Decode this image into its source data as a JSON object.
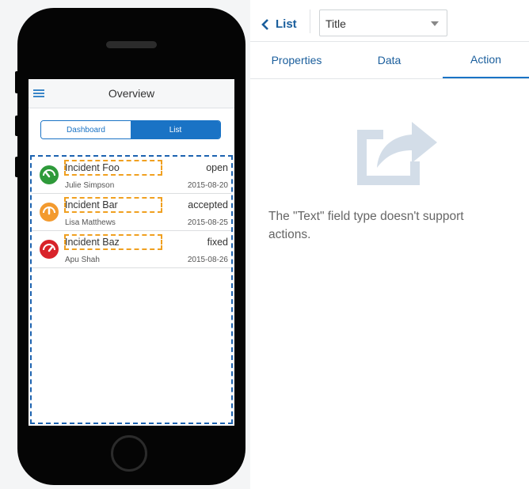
{
  "phone": {
    "app_title": "Overview",
    "segments": {
      "dashboard": "Dashboard",
      "list": "List"
    },
    "incidents": [
      {
        "title": "Incident Foo",
        "status": "open",
        "assignee": "Julie Simpson",
        "date": "2015-08-20",
        "severity_color": "#2e9a3a"
      },
      {
        "title": "Incident Bar",
        "status": "accepted",
        "assignee": "Lisa Matthews",
        "date": "2015-08-25",
        "severity_color": "#f39a2e"
      },
      {
        "title": "Incident Baz",
        "status": "fixed",
        "assignee": "Apu Shah",
        "date": "2015-08-26",
        "severity_color": "#d8232a"
      }
    ]
  },
  "panel": {
    "back_label": "List",
    "field_select_value": "Title",
    "tabs": {
      "properties": "Properties",
      "data": "Data",
      "action": "Action"
    },
    "active_tab": "Action",
    "message": "The \"Text\" field type doesn't support actions."
  },
  "icons": {
    "menu": "hamburger-menu-icon",
    "back": "chevron-left-icon",
    "dropdown": "caret-down-icon",
    "severity": "gauge-icon",
    "share": "share-arrow-icon"
  },
  "colors": {
    "accent": "#1a73c5",
    "link": "#1a5e9c",
    "selection_dash": "#1d63b0",
    "highlight_dash": "#f0a020"
  }
}
